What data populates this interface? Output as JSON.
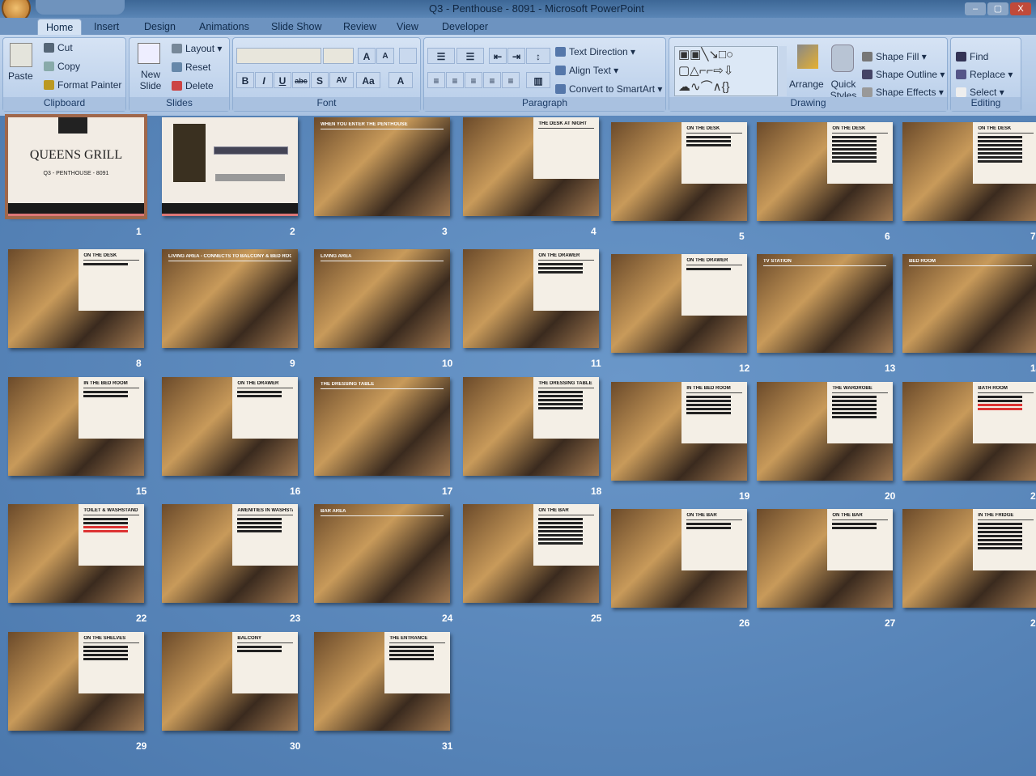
{
  "window": {
    "title": "Q3 - Penthouse - 8091 - Microsoft PowerPoint",
    "minimize": "–",
    "maximize": "▢",
    "close": "X"
  },
  "tabs": [
    "Home",
    "Insert",
    "Design",
    "Animations",
    "Slide Show",
    "Review",
    "View",
    "Developer"
  ],
  "ribbon": {
    "clipboard": {
      "label": "Clipboard",
      "paste": "Paste",
      "cut": "Cut",
      "copy": "Copy",
      "format_painter": "Format Painter"
    },
    "slides": {
      "label": "Slides",
      "new_slide": "New Slide",
      "layout": "Layout",
      "reset": "Reset",
      "delete": "Delete"
    },
    "font": {
      "label": "Font",
      "font_name": "",
      "font_size": "",
      "grow": "A",
      "shrink": "A",
      "bold": "B",
      "italic": "I",
      "underline": "U",
      "strike": "abc",
      "shadow": "S",
      "spacing": "AV",
      "case": "Aa",
      "color": "A"
    },
    "paragraph": {
      "label": "Paragraph",
      "text_direction": "Text Direction",
      "align_text": "Align Text",
      "convert_smartart": "Convert to SmartArt"
    },
    "drawing": {
      "label": "Drawing",
      "arrange": "Arrange",
      "quick_styles": "Quick Styles",
      "shape_fill": "Shape Fill",
      "shape_outline": "Shape Outline",
      "shape_effects": "Shape Effects"
    },
    "editing": {
      "label": "Editing",
      "find": "Find",
      "replace": "Replace",
      "select": "Select"
    }
  },
  "slides": [
    {
      "n": "1",
      "type": "title",
      "title": "QUEENS GRILL",
      "subtitle": "Q3 - PENTHOUSE - 8091",
      "selected": true
    },
    {
      "n": "2",
      "type": "map",
      "title": ""
    },
    {
      "n": "3",
      "type": "top",
      "title": "WHEN YOU ENTER THE PENTHOUSE"
    },
    {
      "n": "4",
      "type": "panel",
      "title": "THE DESK AT NIGHT",
      "lines": 0
    },
    {
      "n": "5",
      "type": "panel",
      "title": "ON THE DESK",
      "lines": 3
    },
    {
      "n": "6",
      "type": "panel",
      "title": "ON THE DESK",
      "lines": 7
    },
    {
      "n": "7",
      "type": "panel",
      "title": "ON THE DESK",
      "lines": 7
    },
    {
      "n": "8",
      "type": "panel",
      "title": "ON THE DESK",
      "lines": 1
    },
    {
      "n": "9",
      "type": "top",
      "title": "LIVING AREA - CONNECTS TO BALCONY & BED ROOM"
    },
    {
      "n": "10",
      "type": "top",
      "title": "LIVING AREA"
    },
    {
      "n": "11",
      "type": "panel",
      "title": "ON THE DRAWER",
      "lines": 3
    },
    {
      "n": "12",
      "type": "panel",
      "title": "ON THE DRAWER",
      "lines": 1
    },
    {
      "n": "13",
      "type": "top",
      "title": "TV STATION"
    },
    {
      "n": "14",
      "type": "top",
      "title": "BED ROOM"
    },
    {
      "n": "15",
      "type": "panel",
      "title": "IN THE BED ROOM",
      "lines": 2
    },
    {
      "n": "16",
      "type": "panel",
      "title": "ON THE DRAWER",
      "lines": 2
    },
    {
      "n": "17",
      "type": "top",
      "title": "THE DRESSING TABLE"
    },
    {
      "n": "18",
      "type": "panel",
      "title": "THE DRESSING TABLE",
      "lines": 5
    },
    {
      "n": "19",
      "type": "panel",
      "title": "IN THE BED ROOM",
      "lines": 5
    },
    {
      "n": "20",
      "type": "panel",
      "title": "THE WARDROBE",
      "lines": 6
    },
    {
      "n": "21",
      "type": "panel",
      "title": "BATH ROOM",
      "lines": 4,
      "red": true
    },
    {
      "n": "22",
      "type": "panel",
      "title": "TOILET & WASHSTAND",
      "lines": 4,
      "red": true
    },
    {
      "n": "23",
      "type": "panel",
      "title": "AMENITIES IN WASHSTAND",
      "lines": 4
    },
    {
      "n": "24",
      "type": "top",
      "title": "BAR AREA"
    },
    {
      "n": "25",
      "type": "panel",
      "title": "ON THE BAR",
      "lines": 7
    },
    {
      "n": "26",
      "type": "panel",
      "title": "ON THE BAR",
      "lines": 2
    },
    {
      "n": "27",
      "type": "panel",
      "title": "ON THE BAR",
      "lines": 2
    },
    {
      "n": "28",
      "type": "panel",
      "title": "IN THE FRIDGE",
      "lines": 7
    },
    {
      "n": "29",
      "type": "panel",
      "title": "ON THE SHELVES",
      "lines": 4
    },
    {
      "n": "30",
      "type": "panel",
      "title": "BALCONY",
      "lines": 2
    },
    {
      "n": "31",
      "type": "panel",
      "title": "THE ENTRANCE",
      "lines": 4
    }
  ],
  "colors": {
    "background": "#4f7fb5",
    "ribbon": "#b7cde9",
    "selection": "#a0674a"
  }
}
